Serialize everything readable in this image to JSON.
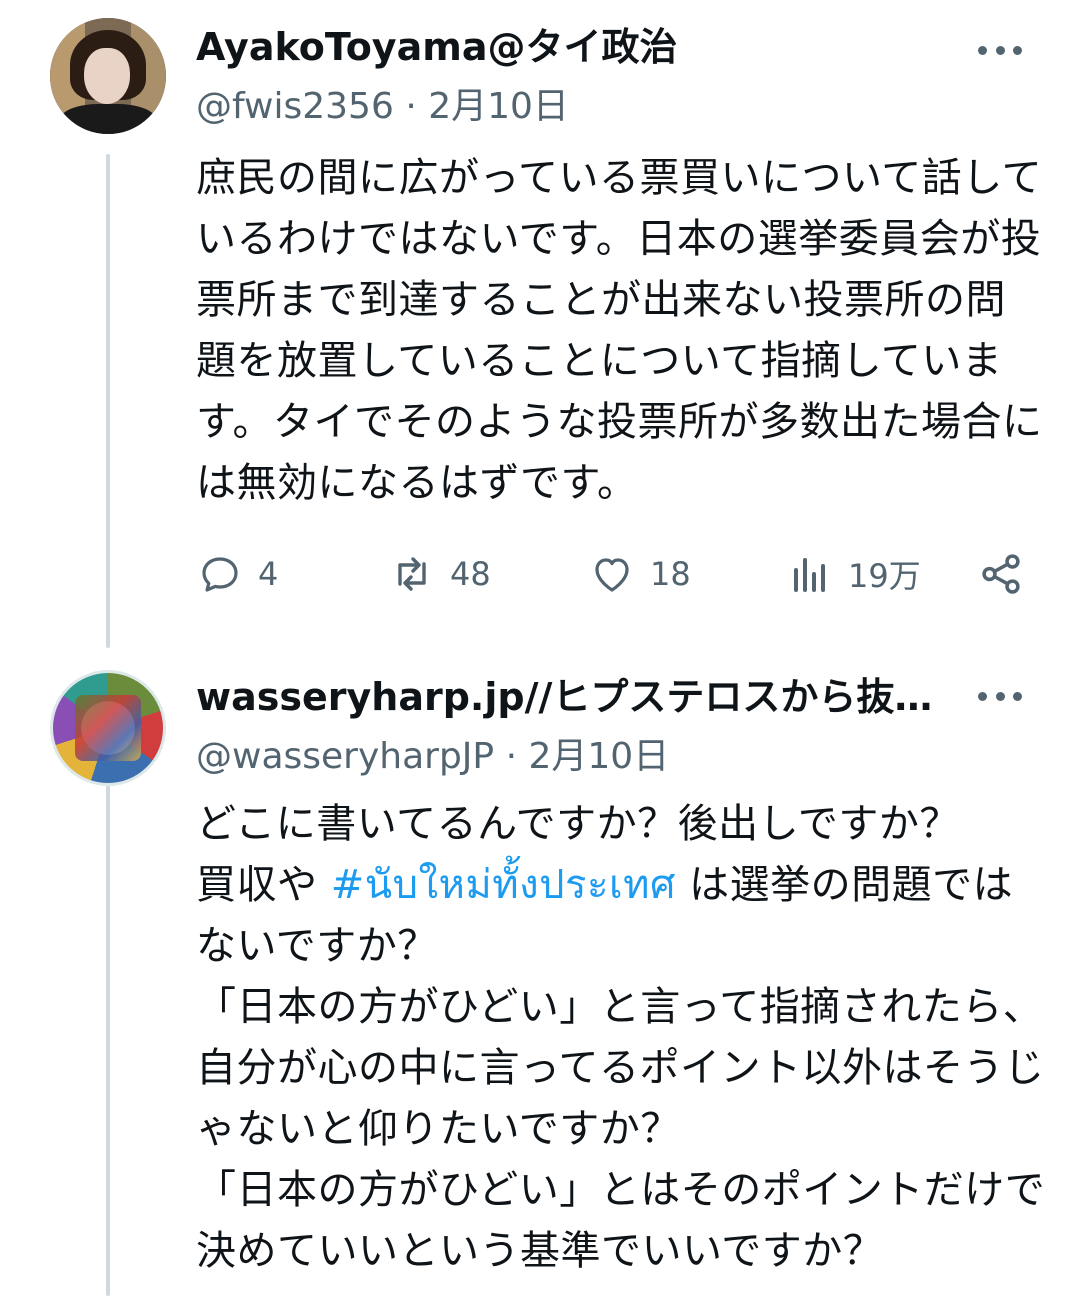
{
  "tweets": [
    {
      "name": "AyakoToyama@タイ政治",
      "handle": "@fwis2356",
      "date_separator": "·",
      "date": "2月10日",
      "text": "庶民の間に広がっている票買いについて話しているわけではないです。日本の選挙委員会が投票所まで到達することが出来ない投票所の問題を放置していることについて指摘しています。タイでそのような投票所が多数出た場合には無効になるはずです。",
      "metrics": {
        "replies": "4",
        "retweets": "48",
        "likes": "18",
        "views": "19万"
      }
    },
    {
      "name": "wasseryharp.jp//ヒプステロスから抜…",
      "handle": "@wasseryharpJP",
      "date_separator": "·",
      "date": "2月10日",
      "text_part1": "どこに書いてるんですか？後出しですか？\n買収や ",
      "hashtag": "#นับใหม่ทั้งประเทศ",
      "text_part2": " は選挙の問題ではないですか？\n「日本の方がひどい」と言って指摘されたら、自分が心の中に言ってるポイント以外はそうじゃないと仰りたいですか？\n「日本の方がひどい」とはそのポイントだけで決めていいという基準でいいですか？"
    }
  ],
  "colors": {
    "text": "#0f1419",
    "secondary": "#536471",
    "hashtag": "#1d9bf0",
    "thread_line": "#cfd9de"
  },
  "icons": [
    "more-icon",
    "reply-icon",
    "retweet-icon",
    "like-icon",
    "views-icon",
    "share-icon"
  ]
}
